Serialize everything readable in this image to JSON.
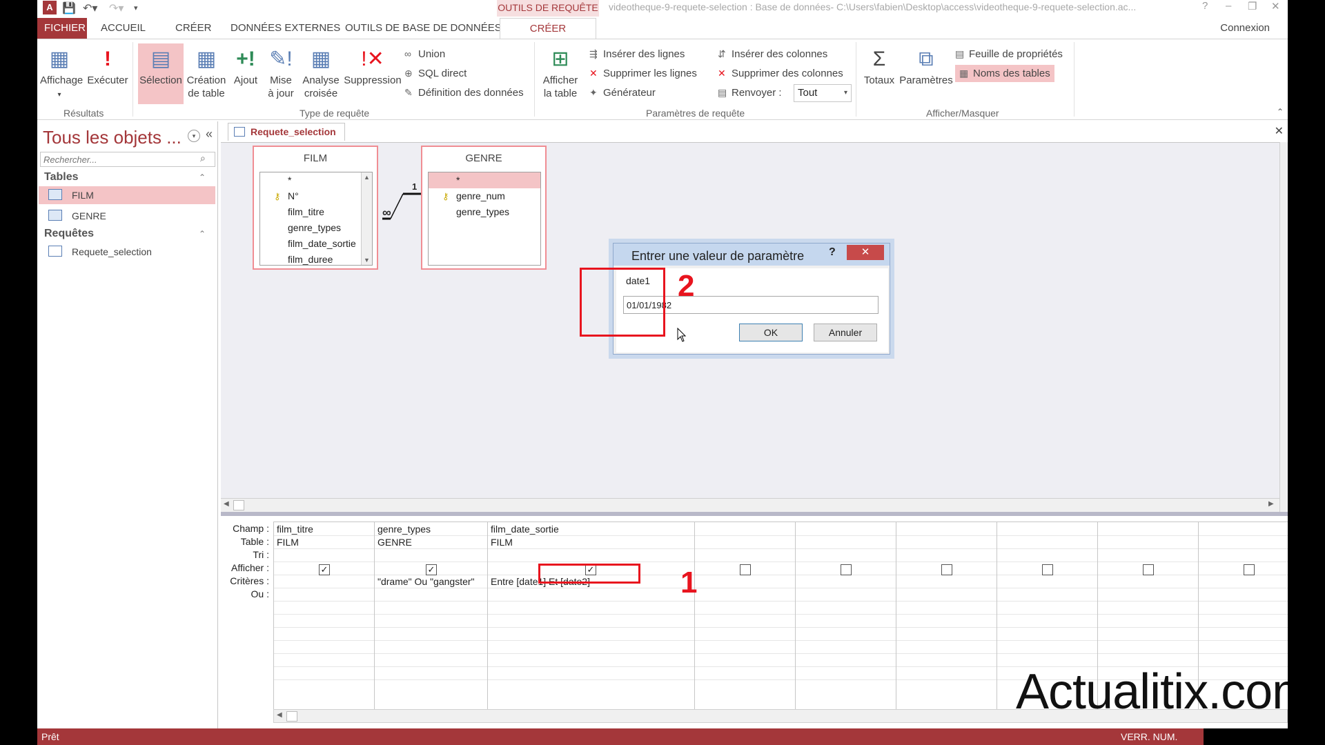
{
  "title_bar": {
    "context_tab_title": "OUTILS DE REQUÊTE",
    "window_title": "videotheque-9-requete-selection : Base de données- C:\\Users\\fabien\\Desktop\\access\\videotheque-9-requete-selection.ac...",
    "help": "?",
    "minimize": "–",
    "restore": "❐",
    "close": "✕"
  },
  "ribbon_tabs": [
    "FICHIER",
    "ACCUEIL",
    "CRÉER",
    "DONNÉES EXTERNES",
    "OUTILS DE BASE DE DONNÉES",
    "CRÉER"
  ],
  "account": "Connexion",
  "ribbon": {
    "resultats": {
      "affichage": "Affichage",
      "executer": "Exécuter",
      "label": "Résultats"
    },
    "type_requete": {
      "selection": "Sélection",
      "creation_table_1": "Création",
      "creation_table_2": "de table",
      "ajout": "Ajout",
      "mise_a_jour_1": "Mise",
      "mise_a_jour_2": "à jour",
      "analyse_1": "Analyse",
      "analyse_2": "croisée",
      "suppression": "Suppression",
      "union": "Union",
      "sql_direct": "SQL direct",
      "definition": "Définition des données",
      "label": "Type de requête"
    },
    "parametres_requete": {
      "afficher_table_1": "Afficher",
      "afficher_table_2": "la table",
      "inserer_lignes": "Insérer des lignes",
      "supprimer_lignes": "Supprimer les lignes",
      "generateur": "Générateur",
      "inserer_colonnes": "Insérer des colonnes",
      "supprimer_colonnes": "Supprimer des colonnes",
      "renvoyer": "Renvoyer :",
      "renvoyer_value": "Tout",
      "label": "Paramètres de requête"
    },
    "afficher_masquer": {
      "totaux": "Totaux",
      "parametres": "Paramètres",
      "feuille_proprietes": "Feuille de propriétés",
      "noms_tables": "Noms des tables",
      "label": "Afficher/Masquer"
    }
  },
  "nav_pane": {
    "title": "Tous les objets ...",
    "search_placeholder": "Rechercher...",
    "groups": [
      {
        "name": "Tables",
        "items": [
          "FILM",
          "GENRE"
        ]
      },
      {
        "name": "Requêtes",
        "items": [
          "Requete_selection"
        ]
      }
    ]
  },
  "document": {
    "tab_title": "Requete_selection",
    "tables": [
      {
        "name": "FILM",
        "fields": [
          "*",
          "N°",
          "film_titre",
          "genre_types",
          "film_date_sortie",
          "film_duree"
        ]
      },
      {
        "name": "GENRE",
        "fields": [
          "*",
          "genre_num",
          "genre_types"
        ]
      }
    ],
    "relation": {
      "one": "1",
      "many": "∞"
    }
  },
  "qbe": {
    "row_labels": [
      "Champ :",
      "Table :",
      "Tri :",
      "Afficher :",
      "Critères :",
      "Ou :"
    ],
    "columns": [
      {
        "champ": "film_titre",
        "table": "FILM",
        "afficher": true,
        "criteres": ""
      },
      {
        "champ": "genre_types",
        "table": "GENRE",
        "afficher": true,
        "criteres": "\"drame\" Ou \"gangster\""
      },
      {
        "champ": "film_date_sortie",
        "table": "FILM",
        "afficher": true,
        "criteres": "Entre [date1] Et [date2]"
      },
      {
        "champ": "",
        "table": "",
        "afficher": false,
        "criteres": ""
      },
      {
        "champ": "",
        "table": "",
        "afficher": false,
        "criteres": ""
      },
      {
        "champ": "",
        "table": "",
        "afficher": false,
        "criteres": ""
      },
      {
        "champ": "",
        "table": "",
        "afficher": false,
        "criteres": ""
      },
      {
        "champ": "",
        "table": "",
        "afficher": false,
        "criteres": ""
      },
      {
        "champ": "",
        "table": "",
        "afficher": false,
        "criteres": ""
      }
    ]
  },
  "annotations": {
    "one": "1",
    "two": "2"
  },
  "dialog": {
    "title": "Entrer une valeur de paramètre",
    "help": "?",
    "close": "✕",
    "prompt": "date1",
    "value": "01/01/1982",
    "ok": "OK",
    "cancel": "Annuler"
  },
  "status": {
    "left": "Prêt",
    "right": "VERR. NUM."
  },
  "watermark": "Actualitix.com",
  "colors": {
    "accent": "#a4373a",
    "highlight": "#f4c4c6",
    "annotation": "#e8141e"
  }
}
